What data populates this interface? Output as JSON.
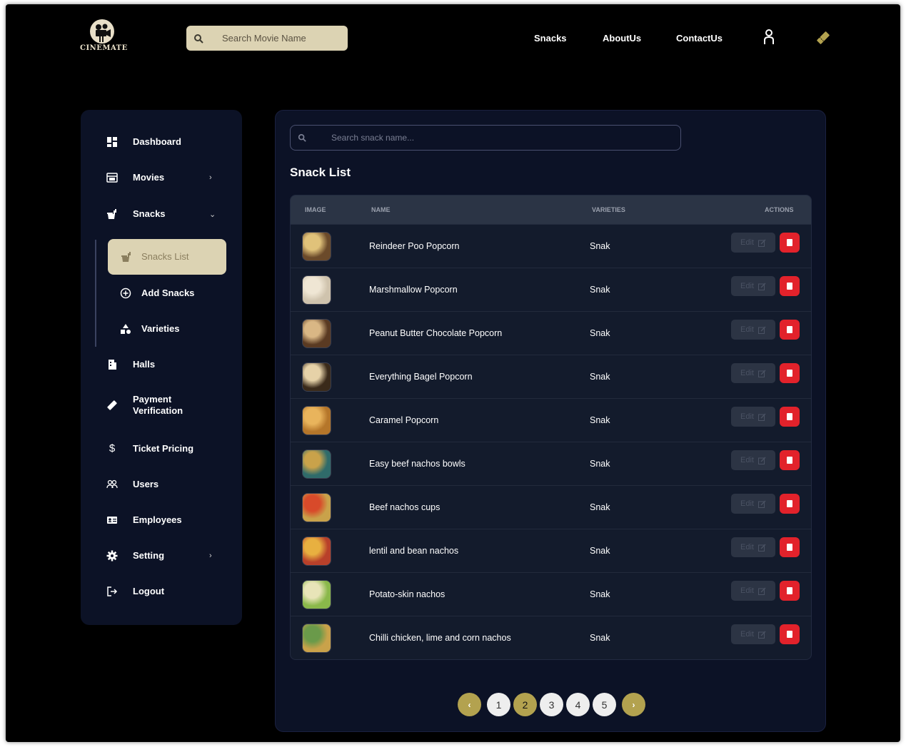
{
  "colors": {
    "accent": "#dcd3b3",
    "gold": "#b3a24f",
    "panel": "#0c1226",
    "danger": "#e2222b"
  },
  "header": {
    "logo_text": "CINEMATE",
    "search_placeholder": "Search Movie Name",
    "nav": [
      "Snacks",
      "AboutUs",
      "ContactUs"
    ],
    "icons": [
      "user-icon",
      "ticket-icon"
    ]
  },
  "sidebar": {
    "items": [
      {
        "label": "Dashboard",
        "icon": "dashboard-icon"
      },
      {
        "label": "Movies",
        "icon": "film-icon",
        "chevron": "›"
      },
      {
        "label": "Snacks",
        "icon": "snacks-icon",
        "chevron": "⌄"
      },
      {
        "label": "Halls",
        "icon": "hall-icon"
      },
      {
        "label": "Payment Verification",
        "icon": "ticket-icon"
      },
      {
        "label": "Ticket Pricing",
        "icon": "dollar-icon"
      },
      {
        "label": "Users",
        "icon": "users-icon"
      },
      {
        "label": "Employees",
        "icon": "id-card-icon"
      },
      {
        "label": "Setting",
        "icon": "gear-icon",
        "chevron": "›"
      },
      {
        "label": "Logout",
        "icon": "logout-icon"
      }
    ],
    "sub_items": [
      {
        "label": "Snacks List",
        "icon": "snacks-icon",
        "active": true
      },
      {
        "label": "Add Snacks",
        "icon": "plus-circle-icon"
      },
      {
        "label": "Varieties",
        "icon": "shapes-icon"
      }
    ]
  },
  "main": {
    "search_placeholder": "Search snack name...",
    "title": "Snack List",
    "columns": [
      "IMAGE",
      "NAME",
      "VARIETIES",
      "ACTIONS"
    ],
    "edit_label": "Edit",
    "rows": [
      {
        "name": "Reindeer Poo Popcorn",
        "variety": "Snak"
      },
      {
        "name": "Marshmallow Popcorn",
        "variety": "Snak"
      },
      {
        "name": "Peanut Butter Chocolate Popcorn",
        "variety": "Snak"
      },
      {
        "name": "Everything Bagel Popcorn",
        "variety": "Snak"
      },
      {
        "name": "Caramel Popcorn",
        "variety": "Snak"
      },
      {
        "name": "Easy beef nachos bowls",
        "variety": "Snak"
      },
      {
        "name": "Beef nachos cups",
        "variety": "Snak"
      },
      {
        "name": "lentil and bean nachos",
        "variety": "Snak"
      },
      {
        "name": "Potato-skin nachos",
        "variety": "Snak"
      },
      {
        "name": "Chilli chicken, lime and corn nachos",
        "variety": "Snak"
      }
    ],
    "pagination": {
      "prev": "‹",
      "pages": [
        "1",
        "2",
        "3",
        "4",
        "5"
      ],
      "current": "2",
      "next": "›"
    }
  }
}
